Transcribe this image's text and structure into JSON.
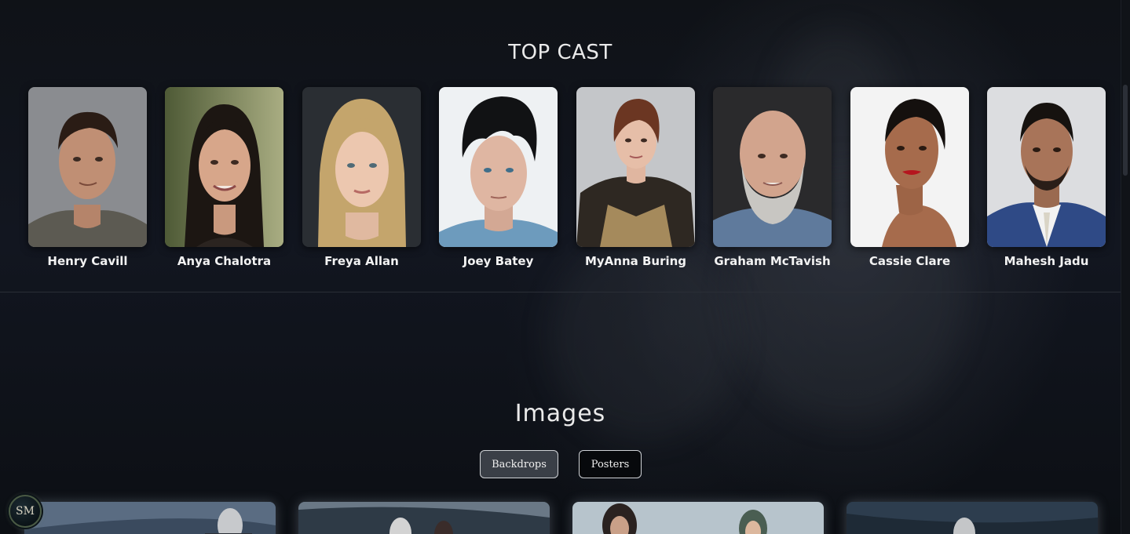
{
  "cast_section": {
    "title": "TOP CAST",
    "members": [
      {
        "name": "Henry Cavill"
      },
      {
        "name": "Anya Chalotra"
      },
      {
        "name": "Freya Allan"
      },
      {
        "name": "Joey Batey"
      },
      {
        "name": "MyAnna Buring"
      },
      {
        "name": "Graham McTavish"
      },
      {
        "name": "Cassie Clare"
      },
      {
        "name": "Mahesh Jadu"
      }
    ]
  },
  "images_section": {
    "title": "Images",
    "tabs": [
      {
        "label": "Backdrops",
        "active": true
      },
      {
        "label": "Posters",
        "active": false
      }
    ]
  },
  "badge": {
    "text": "SM"
  },
  "colors": {
    "background": "#0f1217",
    "active_tab": "#3a3f47",
    "inactive_tab": "#07090c",
    "divider": "#2a2e36"
  }
}
